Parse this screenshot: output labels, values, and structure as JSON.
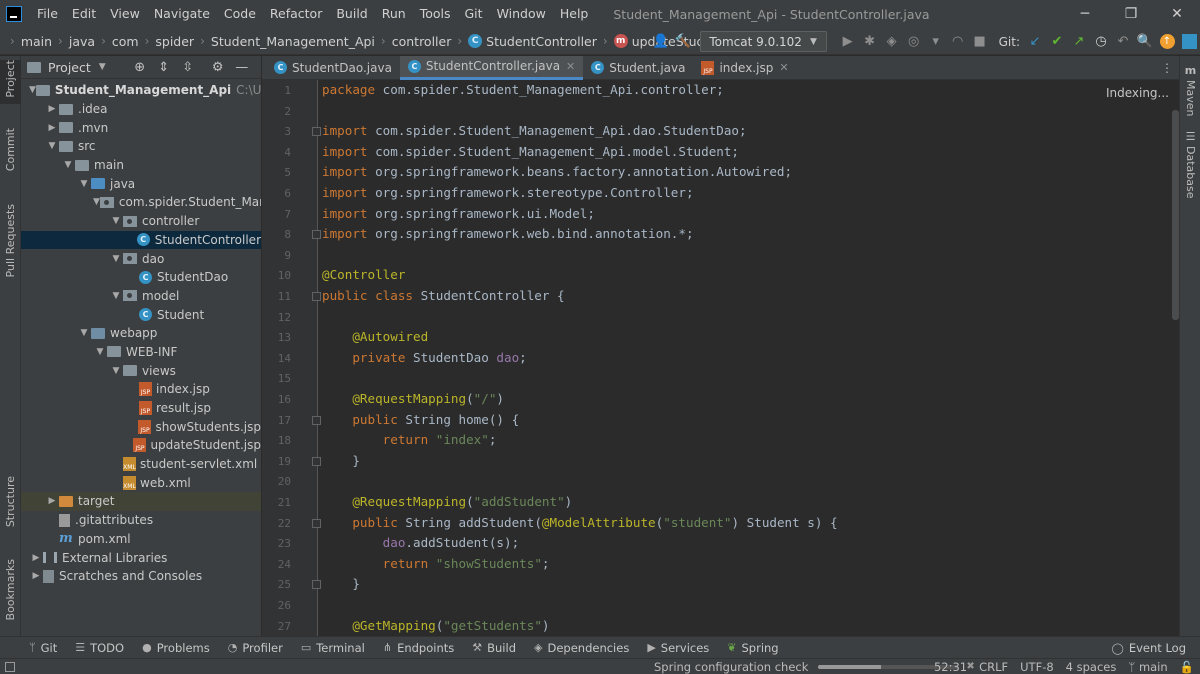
{
  "window": {
    "title": "Student_Management_Api - StudentController.java",
    "menu": [
      "File",
      "Edit",
      "View",
      "Navigate",
      "Code",
      "Refactor",
      "Build",
      "Run",
      "Tools",
      "Git",
      "Window",
      "Help"
    ]
  },
  "navbar": {
    "breadcrumbs": [
      "main",
      "java",
      "com",
      "spider",
      "Student_Management_Api",
      "controller",
      "StudentController",
      "updateStudent"
    ],
    "run_config": "Tomcat 9.0.102",
    "git_label": "Git:"
  },
  "left_strip": [
    "Project",
    "Commit",
    "Pull Requests",
    "Structure",
    "Bookmarks"
  ],
  "right_strip": [
    "Maven",
    "Database"
  ],
  "project_panel": {
    "title": "Project",
    "tree": [
      {
        "label": "Student_Management_Api",
        "hint": "C:\\Users\\KR",
        "depth": 0,
        "icon": "folder",
        "arrow": "open",
        "bold": true
      },
      {
        "label": ".idea",
        "depth": 1,
        "icon": "folder",
        "arrow": "closed"
      },
      {
        "label": ".mvn",
        "depth": 1,
        "icon": "folder",
        "arrow": "closed"
      },
      {
        "label": "src",
        "depth": 1,
        "icon": "folder",
        "arrow": "open"
      },
      {
        "label": "main",
        "depth": 2,
        "icon": "folder",
        "arrow": "open"
      },
      {
        "label": "java",
        "depth": 3,
        "icon": "folder-blue",
        "arrow": "open"
      },
      {
        "label": "com.spider.Student_Manag",
        "depth": 4,
        "icon": "package",
        "arrow": "open"
      },
      {
        "label": "controller",
        "depth": 5,
        "icon": "package",
        "arrow": "open"
      },
      {
        "label": "StudentController",
        "depth": 6,
        "icon": "class",
        "arrow": "none",
        "selected": true
      },
      {
        "label": "dao",
        "depth": 5,
        "icon": "package",
        "arrow": "open"
      },
      {
        "label": "StudentDao",
        "depth": 6,
        "icon": "class",
        "arrow": "none"
      },
      {
        "label": "model",
        "depth": 5,
        "icon": "package",
        "arrow": "open"
      },
      {
        "label": "Student",
        "depth": 6,
        "icon": "class",
        "arrow": "none"
      },
      {
        "label": "webapp",
        "depth": 3,
        "icon": "folder-web",
        "arrow": "open"
      },
      {
        "label": "WEB-INF",
        "depth": 4,
        "icon": "folder",
        "arrow": "open"
      },
      {
        "label": "views",
        "depth": 5,
        "icon": "folder",
        "arrow": "open"
      },
      {
        "label": "index.jsp",
        "depth": 6,
        "icon": "jsp",
        "arrow": "none"
      },
      {
        "label": "result.jsp",
        "depth": 6,
        "icon": "jsp",
        "arrow": "none"
      },
      {
        "label": "showStudents.jsp",
        "depth": 6,
        "icon": "jsp",
        "arrow": "none"
      },
      {
        "label": "updateStudent.jsp",
        "depth": 6,
        "icon": "jsp",
        "arrow": "none"
      },
      {
        "label": "student-servlet.xml",
        "depth": 5,
        "icon": "xml",
        "arrow": "none"
      },
      {
        "label": "web.xml",
        "depth": 5,
        "icon": "xml",
        "arrow": "none"
      },
      {
        "label": "target",
        "depth": 1,
        "icon": "folder-orange",
        "arrow": "closed",
        "target": true
      },
      {
        "label": ".gitattributes",
        "depth": 1,
        "icon": "file",
        "arrow": "none"
      },
      {
        "label": "pom.xml",
        "depth": 1,
        "icon": "maven",
        "arrow": "none"
      },
      {
        "label": "External Libraries",
        "depth": 0,
        "icon": "lib",
        "arrow": "closed"
      },
      {
        "label": "Scratches and Consoles",
        "depth": 0,
        "icon": "scratch",
        "arrow": "closed"
      }
    ]
  },
  "editor_tabs": [
    {
      "label": "StudentDao.java",
      "icon": "class",
      "closable": false
    },
    {
      "label": "StudentController.java",
      "icon": "class",
      "closable": true,
      "active": true
    },
    {
      "label": "Student.java",
      "icon": "class",
      "closable": false
    },
    {
      "label": "index.jsp",
      "icon": "jsp",
      "closable": true
    }
  ],
  "editor": {
    "status": "Indexing...",
    "lines": [
      {
        "n": "1",
        "tokens": [
          [
            "kw",
            "package "
          ],
          [
            "",
            "com.spider.Student_Management_Api.controller;"
          ]
        ]
      },
      {
        "n": "2",
        "tokens": []
      },
      {
        "n": "3",
        "tokens": [
          [
            "kw",
            "import "
          ],
          [
            "",
            "com.spider.Student_Management_Api.dao.StudentDao;"
          ]
        ]
      },
      {
        "n": "4",
        "tokens": [
          [
            "kw",
            "import "
          ],
          [
            "",
            "com.spider.Student_Management_Api.model.Student;"
          ]
        ]
      },
      {
        "n": "5",
        "tokens": [
          [
            "kw",
            "import "
          ],
          [
            "",
            "org.springframework.beans.factory.annotation.Autowired;"
          ]
        ]
      },
      {
        "n": "6",
        "tokens": [
          [
            "kw",
            "import "
          ],
          [
            "",
            "org.springframework.stereotype.Controller;"
          ]
        ]
      },
      {
        "n": "7",
        "tokens": [
          [
            "kw",
            "import "
          ],
          [
            "",
            "org.springframework.ui.Model;"
          ]
        ]
      },
      {
        "n": "8",
        "tokens": [
          [
            "kw",
            "import "
          ],
          [
            "",
            "org.springframework.web.bind.annotation.*;"
          ]
        ]
      },
      {
        "n": "9",
        "tokens": []
      },
      {
        "n": "10",
        "tokens": [
          [
            "ann",
            "@Controller"
          ]
        ]
      },
      {
        "n": "11",
        "tokens": [
          [
            "kw",
            "public class "
          ],
          [
            "",
            "StudentController {"
          ]
        ]
      },
      {
        "n": "12",
        "tokens": []
      },
      {
        "n": "13",
        "tokens": [
          [
            "",
            "    "
          ],
          [
            "ann",
            "@Autowired"
          ]
        ]
      },
      {
        "n": "14",
        "tokens": [
          [
            "",
            "    "
          ],
          [
            "kw",
            "private "
          ],
          [
            "",
            "StudentDao "
          ],
          [
            "fld",
            "dao"
          ],
          [
            "",
            ";"
          ]
        ]
      },
      {
        "n": "15",
        "tokens": []
      },
      {
        "n": "16",
        "tokens": [
          [
            "",
            "    "
          ],
          [
            "ann",
            "@RequestMapping"
          ],
          [
            "",
            "("
          ],
          [
            "str",
            "\"/\""
          ],
          [
            "",
            ")"
          ]
        ]
      },
      {
        "n": "17",
        "tokens": [
          [
            "",
            "    "
          ],
          [
            "kw",
            "public "
          ],
          [
            "",
            "String home() {"
          ]
        ]
      },
      {
        "n": "18",
        "tokens": [
          [
            "",
            "        "
          ],
          [
            "kw",
            "return "
          ],
          [
            "str",
            "\"index\""
          ],
          [
            "",
            ";"
          ]
        ]
      },
      {
        "n": "19",
        "tokens": [
          [
            "",
            "    }"
          ]
        ]
      },
      {
        "n": "20",
        "tokens": []
      },
      {
        "n": "21",
        "tokens": [
          [
            "",
            "    "
          ],
          [
            "ann",
            "@RequestMapping"
          ],
          [
            "",
            "("
          ],
          [
            "str",
            "\"addStudent\""
          ],
          [
            "",
            ")"
          ]
        ]
      },
      {
        "n": "22",
        "tokens": [
          [
            "",
            "    "
          ],
          [
            "kw",
            "public "
          ],
          [
            "",
            "String addStudent("
          ],
          [
            "ann",
            "@ModelAttribute"
          ],
          [
            "",
            "("
          ],
          [
            "str",
            "\"student\""
          ],
          [
            "",
            ") Student s) {"
          ]
        ]
      },
      {
        "n": "23",
        "tokens": [
          [
            "",
            "        "
          ],
          [
            "fld",
            "dao"
          ],
          [
            "",
            ".addStudent(s);"
          ]
        ]
      },
      {
        "n": "24",
        "tokens": [
          [
            "",
            "        "
          ],
          [
            "kw",
            "return "
          ],
          [
            "str",
            "\"showStudents\""
          ],
          [
            "",
            ";"
          ]
        ]
      },
      {
        "n": "25",
        "tokens": [
          [
            "",
            "    }"
          ]
        ]
      },
      {
        "n": "26",
        "tokens": []
      },
      {
        "n": "27",
        "tokens": [
          [
            "",
            "    "
          ],
          [
            "ann",
            "@GetMapping"
          ],
          [
            "",
            "("
          ],
          [
            "str",
            "\"getStudents\""
          ],
          [
            "",
            ")"
          ]
        ]
      }
    ]
  },
  "bottom_tools": [
    {
      "label": "Git",
      "icon": "branch-icon"
    },
    {
      "label": "TODO",
      "icon": "list-icon"
    },
    {
      "label": "Problems",
      "icon": "warning-icon"
    },
    {
      "label": "Profiler",
      "icon": "profiler-icon"
    },
    {
      "label": "Terminal",
      "icon": "terminal-icon"
    },
    {
      "label": "Endpoints",
      "icon": "endpoints-icon"
    },
    {
      "label": "Build",
      "icon": "hammer-icon"
    },
    {
      "label": "Dependencies",
      "icon": "layers-icon"
    },
    {
      "label": "Services",
      "icon": "play-icon"
    },
    {
      "label": "Spring",
      "icon": "leaf-icon"
    }
  ],
  "event_log": "Event Log",
  "status": {
    "task": "Spring configuration check",
    "progress": 0.45,
    "position": "52:31",
    "line_sep": "CRLF",
    "encoding": "UTF-8",
    "indent": "4 spaces",
    "branch": "main"
  }
}
